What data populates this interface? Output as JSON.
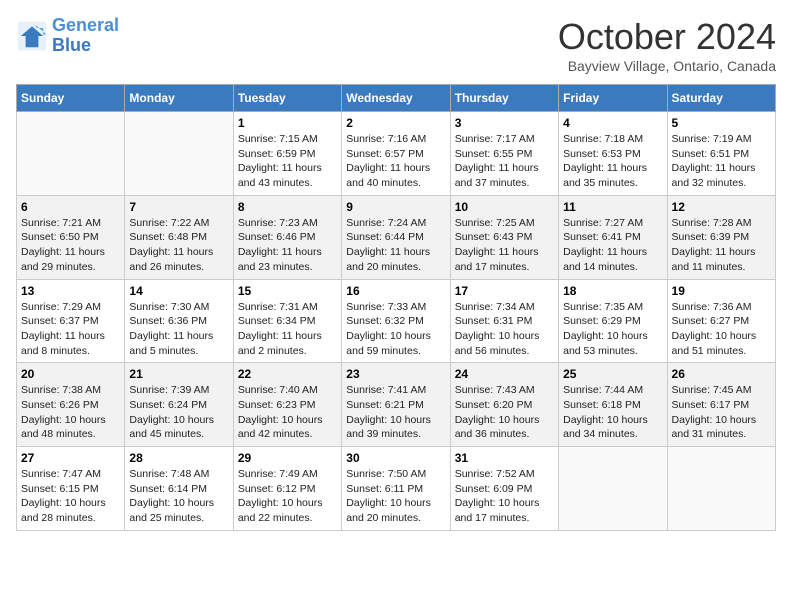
{
  "logo": {
    "line1": "General",
    "line2": "Blue"
  },
  "title": "October 2024",
  "subtitle": "Bayview Village, Ontario, Canada",
  "days_of_week": [
    "Sunday",
    "Monday",
    "Tuesday",
    "Wednesday",
    "Thursday",
    "Friday",
    "Saturday"
  ],
  "weeks": [
    [
      {
        "day": "",
        "text": ""
      },
      {
        "day": "",
        "text": ""
      },
      {
        "day": "1",
        "text": "Sunrise: 7:15 AM\nSunset: 6:59 PM\nDaylight: 11 hours and 43 minutes."
      },
      {
        "day": "2",
        "text": "Sunrise: 7:16 AM\nSunset: 6:57 PM\nDaylight: 11 hours and 40 minutes."
      },
      {
        "day": "3",
        "text": "Sunrise: 7:17 AM\nSunset: 6:55 PM\nDaylight: 11 hours and 37 minutes."
      },
      {
        "day": "4",
        "text": "Sunrise: 7:18 AM\nSunset: 6:53 PM\nDaylight: 11 hours and 35 minutes."
      },
      {
        "day": "5",
        "text": "Sunrise: 7:19 AM\nSunset: 6:51 PM\nDaylight: 11 hours and 32 minutes."
      }
    ],
    [
      {
        "day": "6",
        "text": "Sunrise: 7:21 AM\nSunset: 6:50 PM\nDaylight: 11 hours and 29 minutes."
      },
      {
        "day": "7",
        "text": "Sunrise: 7:22 AM\nSunset: 6:48 PM\nDaylight: 11 hours and 26 minutes."
      },
      {
        "day": "8",
        "text": "Sunrise: 7:23 AM\nSunset: 6:46 PM\nDaylight: 11 hours and 23 minutes."
      },
      {
        "day": "9",
        "text": "Sunrise: 7:24 AM\nSunset: 6:44 PM\nDaylight: 11 hours and 20 minutes."
      },
      {
        "day": "10",
        "text": "Sunrise: 7:25 AM\nSunset: 6:43 PM\nDaylight: 11 hours and 17 minutes."
      },
      {
        "day": "11",
        "text": "Sunrise: 7:27 AM\nSunset: 6:41 PM\nDaylight: 11 hours and 14 minutes."
      },
      {
        "day": "12",
        "text": "Sunrise: 7:28 AM\nSunset: 6:39 PM\nDaylight: 11 hours and 11 minutes."
      }
    ],
    [
      {
        "day": "13",
        "text": "Sunrise: 7:29 AM\nSunset: 6:37 PM\nDaylight: 11 hours and 8 minutes."
      },
      {
        "day": "14",
        "text": "Sunrise: 7:30 AM\nSunset: 6:36 PM\nDaylight: 11 hours and 5 minutes."
      },
      {
        "day": "15",
        "text": "Sunrise: 7:31 AM\nSunset: 6:34 PM\nDaylight: 11 hours and 2 minutes."
      },
      {
        "day": "16",
        "text": "Sunrise: 7:33 AM\nSunset: 6:32 PM\nDaylight: 10 hours and 59 minutes."
      },
      {
        "day": "17",
        "text": "Sunrise: 7:34 AM\nSunset: 6:31 PM\nDaylight: 10 hours and 56 minutes."
      },
      {
        "day": "18",
        "text": "Sunrise: 7:35 AM\nSunset: 6:29 PM\nDaylight: 10 hours and 53 minutes."
      },
      {
        "day": "19",
        "text": "Sunrise: 7:36 AM\nSunset: 6:27 PM\nDaylight: 10 hours and 51 minutes."
      }
    ],
    [
      {
        "day": "20",
        "text": "Sunrise: 7:38 AM\nSunset: 6:26 PM\nDaylight: 10 hours and 48 minutes."
      },
      {
        "day": "21",
        "text": "Sunrise: 7:39 AM\nSunset: 6:24 PM\nDaylight: 10 hours and 45 minutes."
      },
      {
        "day": "22",
        "text": "Sunrise: 7:40 AM\nSunset: 6:23 PM\nDaylight: 10 hours and 42 minutes."
      },
      {
        "day": "23",
        "text": "Sunrise: 7:41 AM\nSunset: 6:21 PM\nDaylight: 10 hours and 39 minutes."
      },
      {
        "day": "24",
        "text": "Sunrise: 7:43 AM\nSunset: 6:20 PM\nDaylight: 10 hours and 36 minutes."
      },
      {
        "day": "25",
        "text": "Sunrise: 7:44 AM\nSunset: 6:18 PM\nDaylight: 10 hours and 34 minutes."
      },
      {
        "day": "26",
        "text": "Sunrise: 7:45 AM\nSunset: 6:17 PM\nDaylight: 10 hours and 31 minutes."
      }
    ],
    [
      {
        "day": "27",
        "text": "Sunrise: 7:47 AM\nSunset: 6:15 PM\nDaylight: 10 hours and 28 minutes."
      },
      {
        "day": "28",
        "text": "Sunrise: 7:48 AM\nSunset: 6:14 PM\nDaylight: 10 hours and 25 minutes."
      },
      {
        "day": "29",
        "text": "Sunrise: 7:49 AM\nSunset: 6:12 PM\nDaylight: 10 hours and 22 minutes."
      },
      {
        "day": "30",
        "text": "Sunrise: 7:50 AM\nSunset: 6:11 PM\nDaylight: 10 hours and 20 minutes."
      },
      {
        "day": "31",
        "text": "Sunrise: 7:52 AM\nSunset: 6:09 PM\nDaylight: 10 hours and 17 minutes."
      },
      {
        "day": "",
        "text": ""
      },
      {
        "day": "",
        "text": ""
      }
    ]
  ]
}
